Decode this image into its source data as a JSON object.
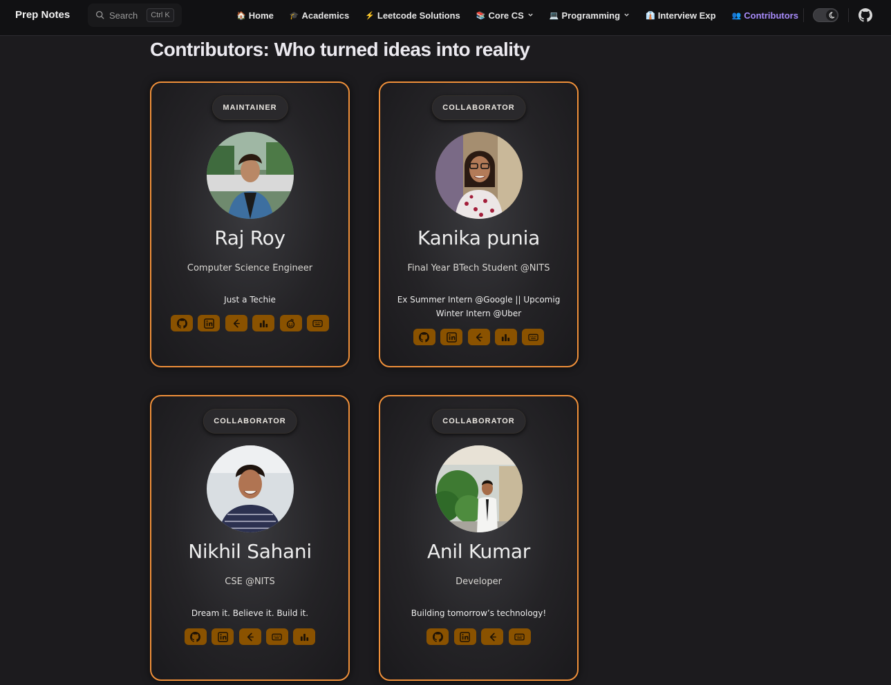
{
  "navbar": {
    "brand": "Prep Notes",
    "search": {
      "placeholder": "Search",
      "shortcut": "Ctrl K"
    },
    "links": [
      {
        "emoji": "🏠",
        "label": "Home",
        "dropdown": false,
        "active": false
      },
      {
        "emoji": "🎓",
        "label": "Academics",
        "dropdown": false,
        "active": false
      },
      {
        "emoji": "⚡",
        "label": "Leetcode Solutions",
        "dropdown": false,
        "active": false
      },
      {
        "emoji": "📚",
        "label": "Core CS",
        "dropdown": true,
        "active": false
      },
      {
        "emoji": "💻",
        "label": "Programming",
        "dropdown": true,
        "active": false
      },
      {
        "emoji": "👔",
        "label": "Interview Exp",
        "dropdown": false,
        "active": false
      },
      {
        "emoji": "👥",
        "label": "Contributors",
        "dropdown": false,
        "active": true
      }
    ],
    "theme_toggle": "dark",
    "github_icon": "github-icon"
  },
  "page": {
    "title": "Contributors: Who turned ideas into reality"
  },
  "colors": {
    "accent_border": "#f0903a",
    "social_button": "#8a5200",
    "social_icon": "#1e1205",
    "active_nav": "#a78bfa",
    "background": "#1c1b1e"
  },
  "contributors": [
    {
      "role": "MAINTAINER",
      "name": "Raj Roy",
      "title": "Computer Science Engineer",
      "bio": "Just a Techie",
      "socials": [
        "github-icon",
        "linkedin-icon",
        "leetcode-icon",
        "stats-icon",
        "reddit-icon",
        "keyboard-icon"
      ]
    },
    {
      "role": "COLLABORATOR",
      "name": "Kanika punia",
      "title": "Final Year BTech Student @NITS",
      "bio": "Ex Summer Intern @Google || Upcomig Winter Intern @Uber",
      "socials": [
        "github-icon",
        "linkedin-icon",
        "leetcode-icon",
        "stats-icon",
        "keyboard-icon"
      ]
    },
    {
      "role": "COLLABORATOR",
      "name": "Nikhil Sahani",
      "title": "CSE @NITS",
      "bio": "Dream it. Believe it. Build it.",
      "socials": [
        "github-icon",
        "linkedin-icon",
        "leetcode-icon",
        "keyboard-icon",
        "stats-icon"
      ]
    },
    {
      "role": "COLLABORATOR",
      "name": "Anil Kumar",
      "title": "Developer",
      "bio": "Building tomorrow’s technology!",
      "socials": [
        "github-icon",
        "linkedin-icon",
        "leetcode-icon",
        "keyboard-icon"
      ]
    }
  ]
}
